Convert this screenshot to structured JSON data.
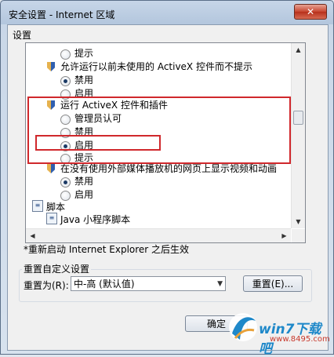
{
  "window": {
    "title": "安全设置 - Internet 区域",
    "close_symbol": "✕"
  },
  "settings": {
    "group_label": "设置",
    "items": [
      {
        "type": "option",
        "label": "提示",
        "selected": false
      },
      {
        "type": "setting",
        "label": "允许运行以前未使用的 ActiveX 控件而不提示"
      },
      {
        "type": "option",
        "label": "禁用",
        "selected": true
      },
      {
        "type": "option",
        "label": "启用",
        "selected": false
      },
      {
        "type": "setting",
        "label": "运行 ActiveX 控件和插件"
      },
      {
        "type": "option",
        "label": "管理员认可",
        "selected": false
      },
      {
        "type": "option",
        "label": "禁用",
        "selected": false
      },
      {
        "type": "option",
        "label": "启用",
        "selected": true
      },
      {
        "type": "option",
        "label": "提示",
        "selected": false
      },
      {
        "type": "setting",
        "label": "在没有使用外部媒体播放机的网页上显示视频和动画"
      },
      {
        "type": "option",
        "label": "禁用",
        "selected": true
      },
      {
        "type": "option",
        "label": "启用",
        "selected": false
      },
      {
        "type": "category",
        "label": "脚本"
      },
      {
        "type": "category",
        "label": "Java 小程序脚本"
      }
    ],
    "restart_note": "*重新启动 Internet Explorer 之后生效"
  },
  "reset": {
    "group_label": "重置自定义设置",
    "reset_to_label": "重置为(R):",
    "selected_level": "中-高 (默认值)",
    "reset_button": "重置(E)..."
  },
  "footer": {
    "ok_button": "确定"
  },
  "watermark": {
    "brand": "win7下载吧",
    "url": "www.8495.com"
  },
  "colors": {
    "highlight": "#d0282c",
    "title_bar": "#b3c6dd"
  }
}
